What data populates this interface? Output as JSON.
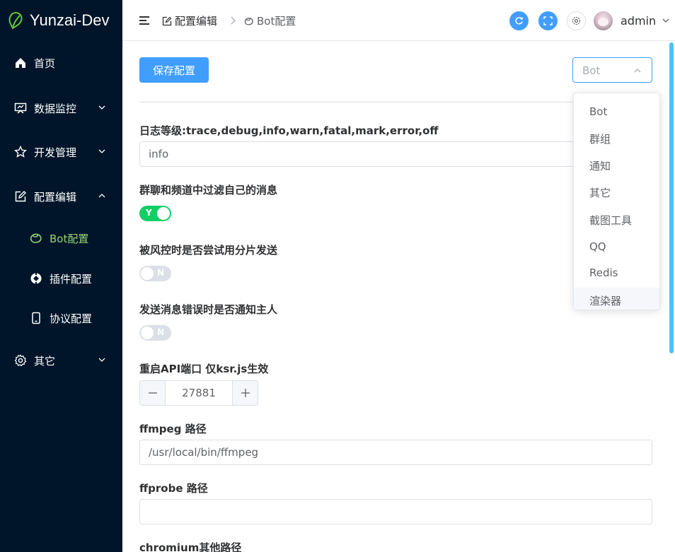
{
  "brand": {
    "name": "Yunzai-Dev"
  },
  "sidebar": {
    "items": [
      {
        "label": "首页",
        "icon": "home-icon"
      },
      {
        "label": "数据监控",
        "icon": "monitor-icon"
      },
      {
        "label": "开发管理",
        "icon": "star-icon"
      },
      {
        "label": "配置编辑",
        "icon": "edit-icon"
      },
      {
        "label": "Bot配置",
        "icon": "bot-icon"
      },
      {
        "label": "插件配置",
        "icon": "plugin-icon"
      },
      {
        "label": "协议配置",
        "icon": "phone-icon"
      },
      {
        "label": "其它",
        "icon": "gear-icon"
      }
    ]
  },
  "header": {
    "breadcrumb": [
      "配置编辑",
      "Bot配置"
    ],
    "username": "admin"
  },
  "toolbar": {
    "save_label": "保存配置",
    "select_value": "Bot"
  },
  "dropdown": {
    "options": [
      "Bot",
      "群组",
      "通知",
      "其它",
      "截图工具",
      "QQ",
      "Redis",
      "渲染器"
    ]
  },
  "form": {
    "log_level": {
      "label": "日志等级:trace,debug,info,warn,fatal,mark,error,off",
      "value": "info"
    },
    "filter_self": {
      "label": "群聊和频道中过滤自己的消息",
      "state": "Y"
    },
    "split_send": {
      "label": "被风控时是否尝试用分片发送",
      "state": "N"
    },
    "notify_master": {
      "label": "发送消息错误时是否通知主人",
      "state": "N"
    },
    "restart_port": {
      "label": "重启API端口 仅ksr.js生效",
      "value": "27881"
    },
    "ffmpeg": {
      "label": "ffmpeg 路径",
      "value": "/usr/local/bin/ffmpeg"
    },
    "ffprobe": {
      "label": "ffprobe 路径",
      "value": ""
    },
    "chromium": {
      "label": "chromium其他路径"
    }
  },
  "colors": {
    "sidebar_bg": "#001529",
    "primary": "#409eff",
    "switch_on": "#13ce66",
    "active_menu": "#95d475"
  }
}
